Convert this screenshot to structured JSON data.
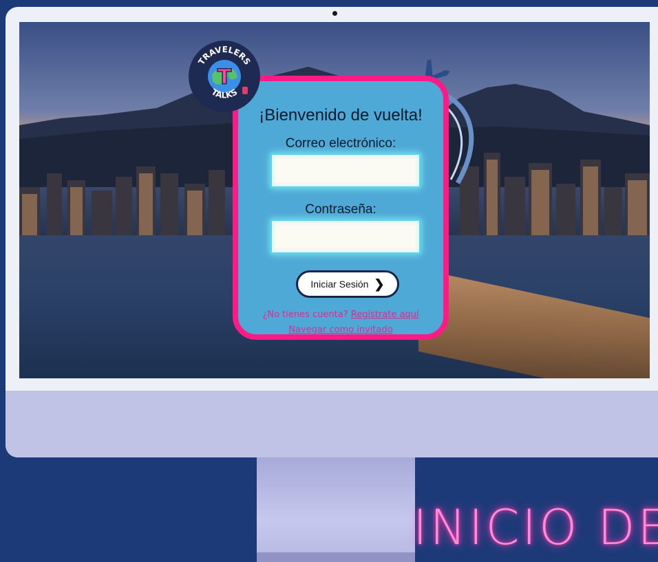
{
  "logo": {
    "top_text": "TRAVELERS",
    "bottom_text": "TALKS",
    "monogram": "T"
  },
  "login": {
    "welcome": "¡Bienvenido de vuelta!",
    "email_label": "Correo electrónico:",
    "email_value": "",
    "password_label": "Contraseña:",
    "password_value": "",
    "submit_label": "Iniciar Sesión",
    "submit_icon": "chevron-right-icon",
    "signup_prompt": "¿No tienes cuenta?",
    "signup_link": "Regístrate aquí",
    "guest_link": "Navegar como invitado"
  },
  "banner": {
    "title": "INICIO DE"
  },
  "colors": {
    "page_background": "#1c3a78",
    "card_background": "#4fa9d6",
    "card_border": "#ff1a86",
    "link": "#e02a8e",
    "input_glow": "#57d2e6",
    "neon_title": "#ff8bd6"
  }
}
